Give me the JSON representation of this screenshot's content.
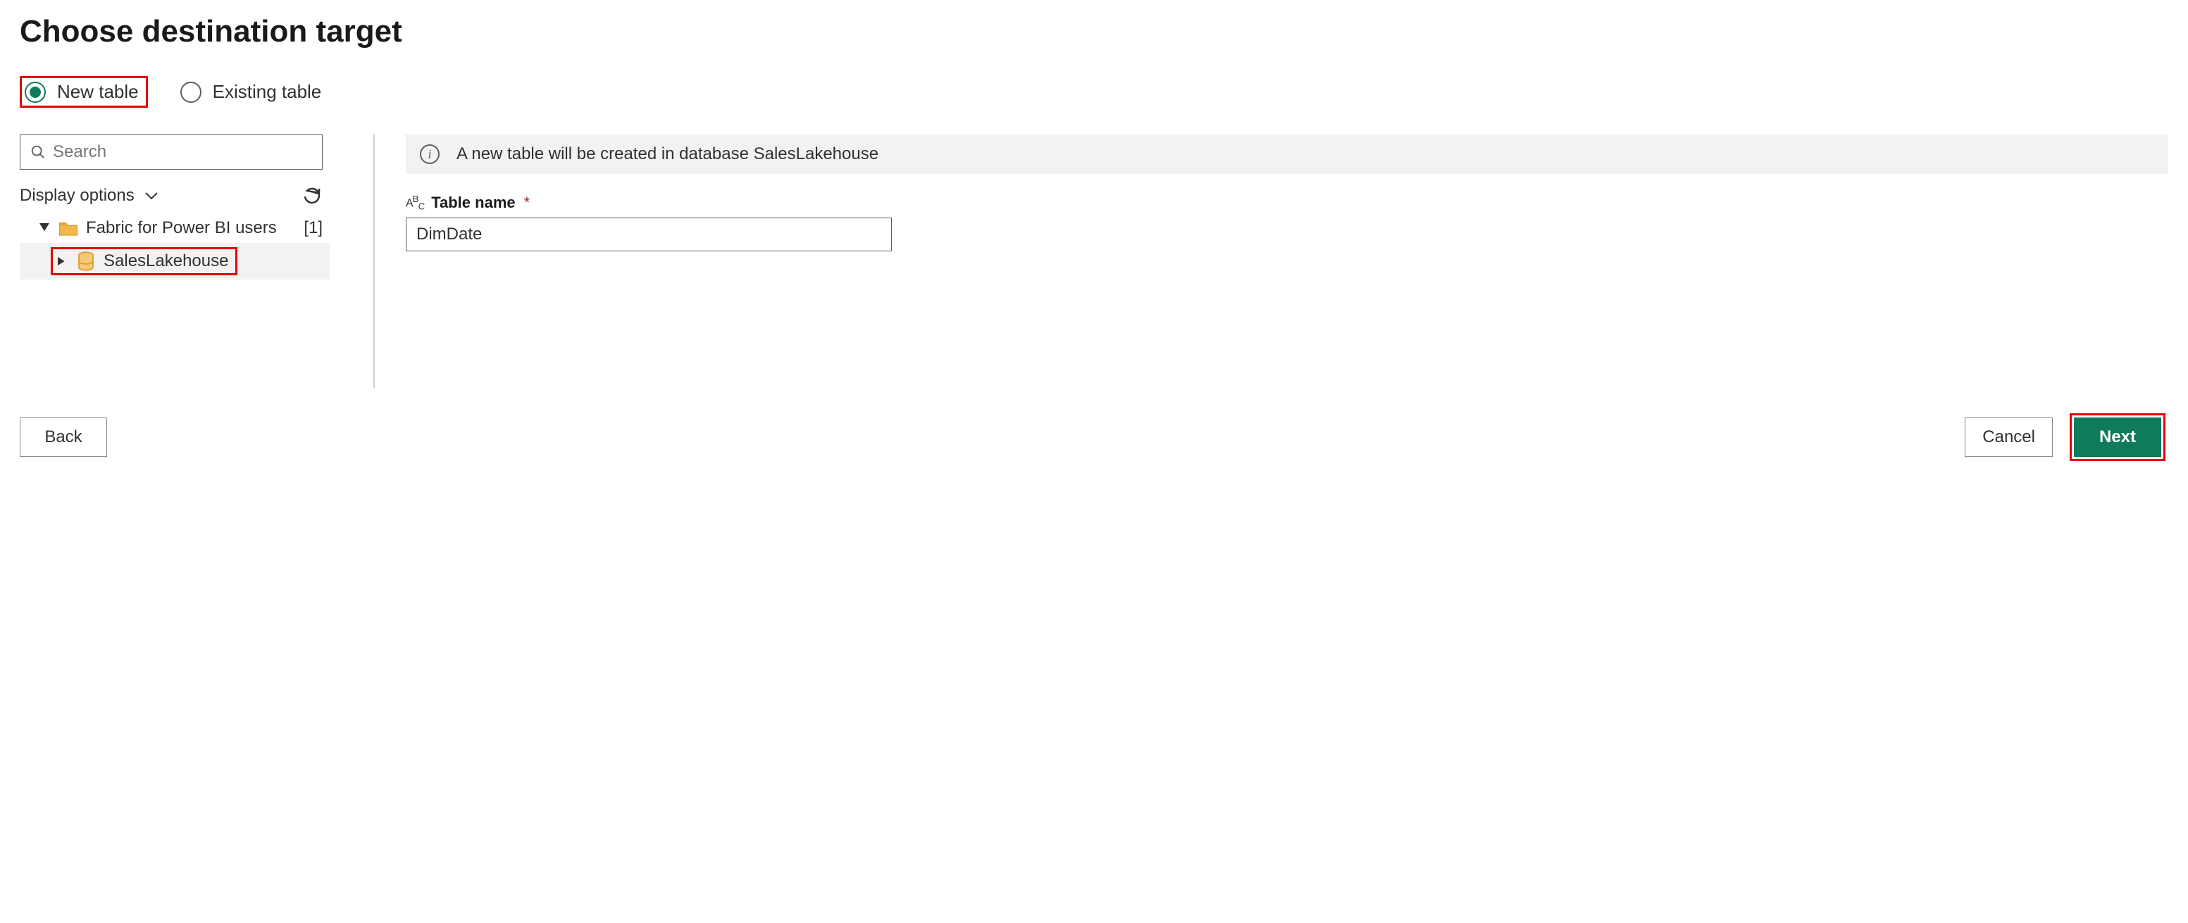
{
  "title": "Choose destination target",
  "radios": {
    "new_table": "New table",
    "existing_table": "Existing table"
  },
  "left": {
    "search_placeholder": "Search",
    "display_options": "Display options",
    "tree": {
      "workspace_label": "Fabric for Power BI users",
      "workspace_count": "[1]",
      "lakehouse_label": "SalesLakehouse"
    }
  },
  "right": {
    "info_text": "A new table will be created in database SalesLakehouse",
    "table_name_label": "Table name",
    "table_name_value": "DimDate"
  },
  "footer": {
    "back": "Back",
    "cancel": "Cancel",
    "next": "Next"
  }
}
